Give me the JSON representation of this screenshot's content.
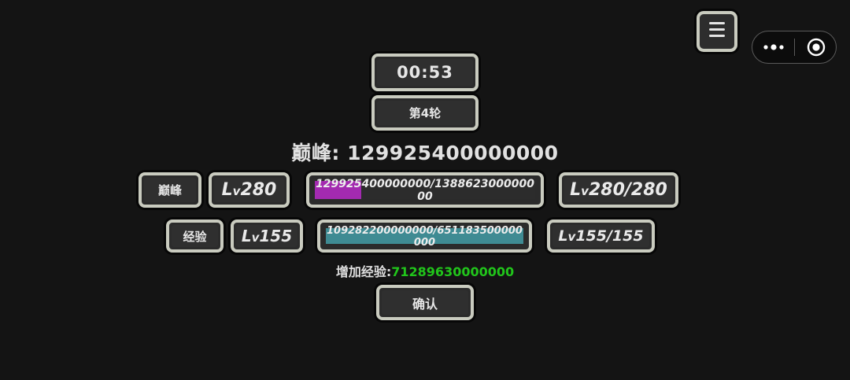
{
  "timer": "00:53",
  "round_label": "第4轮",
  "peak": {
    "title_label": "巅峰: ",
    "title_value": "129925400000000",
    "tag": "巅峰",
    "level_prefix": "L",
    "level_sub": "v",
    "level": "280",
    "progress_text": "129925400000000/138862300000000",
    "progress_fraction": 0.21,
    "progress_color": "#a32ab0",
    "max_level": "280/280"
  },
  "exp": {
    "tag": "经验",
    "level_prefix": "L",
    "level_sub": "v",
    "level": "155",
    "progress_text": "109282200000000/651183500000000",
    "progress_fraction": 1.0,
    "progress_color": "#3f8b93",
    "max_level": "155/155"
  },
  "gain": {
    "label": "增加经验:",
    "value": "71289630000000"
  },
  "confirm_label": "确认",
  "icons": {
    "menu": "menu-icon",
    "more": "more-dots-icon",
    "close": "target-close-icon"
  }
}
